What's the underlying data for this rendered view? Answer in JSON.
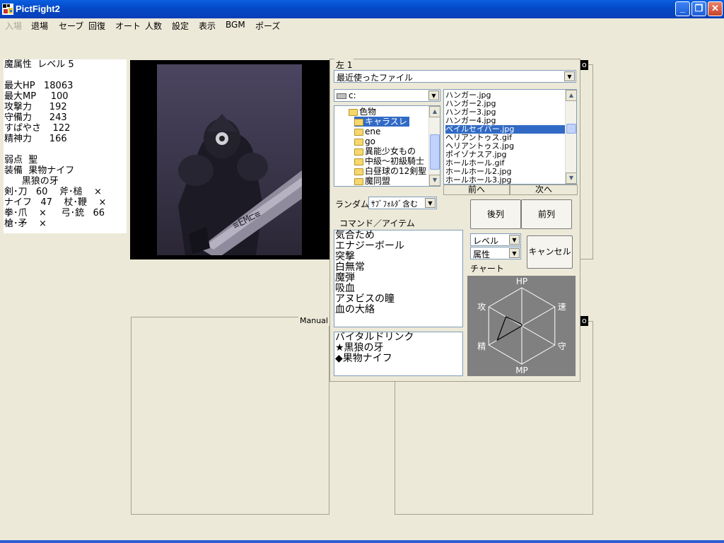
{
  "window": {
    "title": "PictFight2",
    "minimize": "_",
    "restore": "❐",
    "close": "✕"
  },
  "menu": [
    {
      "label": "入場",
      "disabled": true
    },
    {
      "label": "退場"
    },
    {
      "label": "セーブ"
    },
    {
      "label": "回復"
    },
    {
      "label": "オート"
    },
    {
      "label": "人数"
    },
    {
      "label": "設定"
    },
    {
      "label": "表示"
    },
    {
      "label": "BGM"
    },
    {
      "label": "ポーズ"
    }
  ],
  "stats": {
    "lines": [
      "魔属性  レベル 5",
      "",
      "最大HP   18063",
      "最大MP     100",
      "攻撃力      192",
      "守備力      243",
      "すばやさ    122",
      "精神力      166",
      "",
      "弱点  聖",
      "装備  果物ナイフ",
      "      黒狼の牙",
      "剣･刀   60    斧･槌    ×",
      "ナイフ   47    杖･鞭    ×",
      "拳･爪    ×     弓･銃   66",
      "槍･矛    ×"
    ]
  },
  "tags": {
    "top_right": "o",
    "bottom_right": "o",
    "manual": "Manual"
  },
  "panel": {
    "title": "左 1",
    "recent_files": "最近使ったファイル",
    "drive": "c:",
    "folders": [
      {
        "label": "色物",
        "indent": 1,
        "open": true
      },
      {
        "label": "キャラスレ",
        "indent": 2,
        "open": true,
        "selected": true
      },
      {
        "label": "ene",
        "indent": 3
      },
      {
        "label": "go",
        "indent": 3
      },
      {
        "label": "異能少女もの",
        "indent": 3
      },
      {
        "label": "中級〜初級騎士",
        "indent": 3
      },
      {
        "label": "白昼球の12剣聖",
        "indent": 3
      },
      {
        "label": "魔同盟",
        "indent": 3
      }
    ],
    "files": [
      {
        "label": "ハンガー.jpg"
      },
      {
        "label": "ハンガー2.jpg"
      },
      {
        "label": "ハンガー3.jpg"
      },
      {
        "label": "ハンガー4.jpg"
      },
      {
        "label": "ベイルセイバー.jpg",
        "selected": true
      },
      {
        "label": "ヘリアントゥス.gif"
      },
      {
        "label": "ヘリアントゥス.jpg"
      },
      {
        "label": "ポイゾナスア.jpg"
      },
      {
        "label": "ホールホール.gif"
      },
      {
        "label": "ホールホール2.jpg"
      },
      {
        "label": "ホールホール3.jpg"
      }
    ],
    "prev_button": "前へ",
    "next_button": "次へ",
    "random_label": "ランダム",
    "random_value": "ｻﾌﾞﾌｫﾙﾀﾞ含む",
    "back_row_button": "後列",
    "front_row_button": "前列",
    "command_label": "コマンド／アイテム",
    "commands": [
      "気合ため",
      "エナジーボール",
      "突撃",
      "白無常",
      "魔弾",
      "吸血",
      "アヌビスの瞳",
      "血の大絡"
    ],
    "items": [
      "バイタルドリンク",
      "★黒狼の牙",
      "◆果物ナイフ"
    ],
    "sort1": "レベル",
    "sort2": "属性",
    "cancel_button": "キャンセル",
    "chart_label": "チャート",
    "radar": {
      "axes": [
        "HP",
        "速",
        "守",
        "MP",
        "精",
        "攻"
      ],
      "values": [
        0.04,
        0.0,
        0.0,
        0.0,
        0.74,
        0.48
      ]
    }
  }
}
